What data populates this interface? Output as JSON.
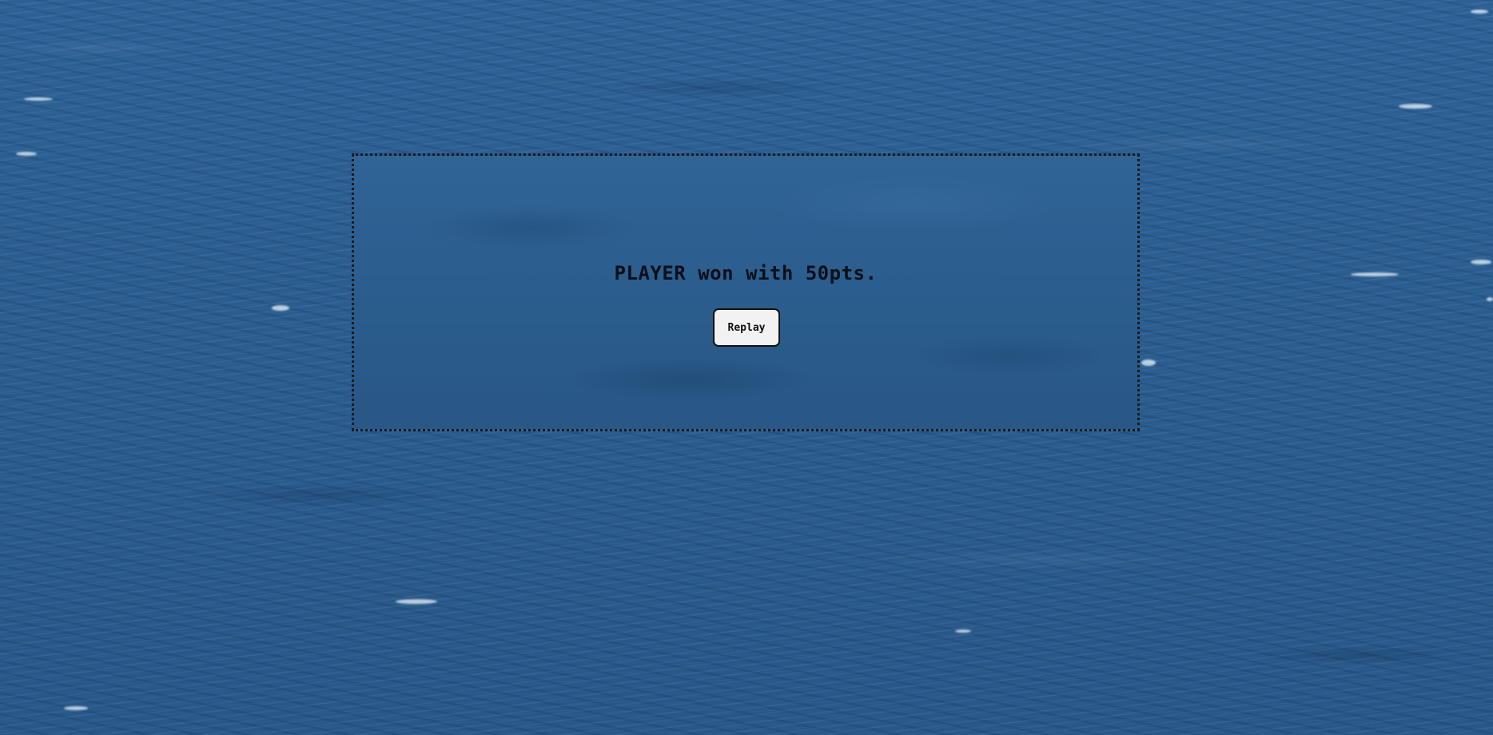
{
  "game_over": {
    "message": "PLAYER won with 50pts.",
    "replay_label": "Replay"
  },
  "colors": {
    "ocean": "#2c5f8f",
    "dialog_background": "#306699",
    "dialog_border": "#1a1a1a",
    "button_background": "#f2f2f2",
    "text": "#0c0f18"
  }
}
